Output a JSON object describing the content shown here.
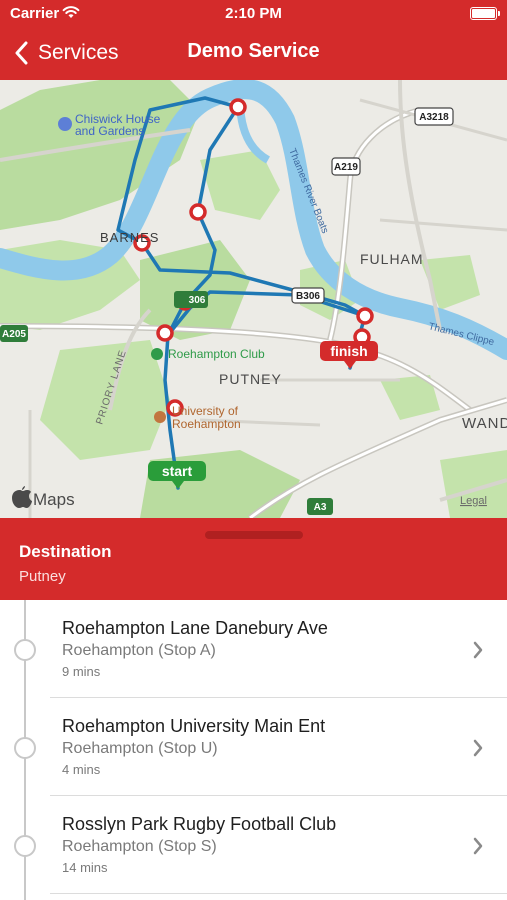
{
  "status_bar": {
    "carrier": "Carrier",
    "time": "2:10 PM"
  },
  "nav": {
    "back_label": "Services",
    "title": "Demo Service"
  },
  "map": {
    "labels": {
      "chiswick_1": "Chiswick House",
      "chiswick_2": "and Gardens",
      "barnes": "BARNES",
      "fulham": "FULHAM",
      "putney": "PUTNEY",
      "wand": "WAND",
      "river": "Thames River Boats",
      "thames_clipper": "Thames Clippe",
      "priory_lane": "PRIORY LANE",
      "roehampton_club": "Roehampton Club",
      "univ_1": "University of",
      "univ_2": "Roehampton"
    },
    "road_shields": {
      "a3218": "A3218",
      "a219": "A219",
      "b306": "B306",
      "a205": "A205",
      "a3": "A3",
      "green_306": "306"
    },
    "markers": {
      "start": "start",
      "finish": "finish"
    },
    "attribution": {
      "brand": "Maps",
      "legal": "Legal"
    },
    "colors": {
      "route": "#1f78b4",
      "stop_marker": "#d42b2b",
      "start": "#2a9d3a",
      "finish": "#d42b2b"
    }
  },
  "destination": {
    "label": "Destination",
    "value": "Putney"
  },
  "stops": [
    {
      "name": "Roehampton Lane  Danebury Ave",
      "area": "Roehampton (Stop A)",
      "duration": "9 mins"
    },
    {
      "name": "Roehampton University Main Ent",
      "area": "Roehampton (Stop U)",
      "duration": "4 mins"
    },
    {
      "name": "Rosslyn Park Rugby Football Club",
      "area": "Roehampton (Stop S)",
      "duration": "14 mins"
    }
  ],
  "theme": {
    "brand_red": "#d42b2b"
  }
}
